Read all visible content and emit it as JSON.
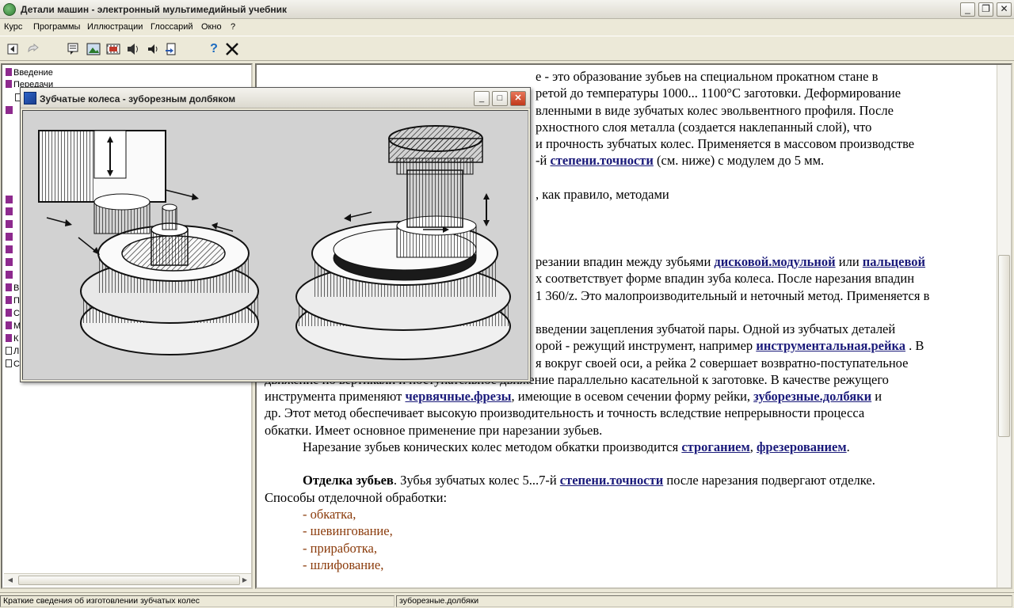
{
  "window": {
    "title": "Детали машин - электронный мультимедийный учебник",
    "minimize": "_",
    "maximize": "❐",
    "close": "✕"
  },
  "menu": [
    "Курс",
    "Программы",
    "Иллюстрации",
    "Глоссарий",
    "Окно",
    "?"
  ],
  "tree": {
    "top_items": [
      "Введение",
      "Передачи"
    ],
    "bottom_items": [
      "В",
      "П",
      "С",
      "М",
      "К",
      "Л",
      "С"
    ]
  },
  "popup": {
    "title": "Зубчатые колеса - зуборезным долбяком",
    "minimize": "_",
    "maximize": "□",
    "close": "✕"
  },
  "content": {
    "lines": [
      {
        "type": "plain",
        "text": "е - это образование зубьев на специальном прокатном стане в"
      },
      {
        "type": "plain",
        "text": "ретой до температуры 1000... 1100°С заготовки. Деформирование"
      },
      {
        "type": "plain",
        "text": "вленными в виде зубчатых колес эвольвентного профиля. После"
      },
      {
        "type": "plain",
        "text": "рхностного слоя металла (создается наклепанный слой), что"
      },
      {
        "type": "plain",
        "text": "и прочность зубчатых колес. Применяется в массовом производстве"
      }
    ],
    "line6_pre": "-й ",
    "line6_link": "степени.точности",
    "line6_post": " (см. ниже) с модулем до 5 мм.",
    "line7": ", как правило, методами",
    "line8_pre": "резании впадин между зубьями ",
    "line8_link1": "дисковой.модульной",
    "line8_mid": " или ",
    "line8_link2": "пальцевой",
    "line9": "х соответствует форме впадин зуба колеса. После нарезания впадин",
    "line10": "1 360/z. Это малопроизводительный и неточный метод.  Применяется  в",
    "line11": "введении зацепления зубчатой пары. Одной из зубчатых деталей",
    "line12_pre": "орой - режущий инструмент, например ",
    "line12_link": "инструментальная.рейка",
    "line12_post": " . В",
    "line13": "я вокруг своей оси, а рейка 2 совершает возвратно-поступательное",
    "line14": "движение по вертикали и поступательное движение параллельно касательной к заготовке. В качестве режущего",
    "line15_pre": "инструмента применяют ",
    "line15_link1": "червячные.фрезы",
    "line15_mid": ", имеющие в осевом сечении форму рейки, ",
    "line15_link2": "зуборезные.долбяки",
    "line15_post": " и",
    "line16": "др. Этот метод обеспечивает высокую производительность и точность вследствие непрерывности процесса",
    "line17": "обкатки. Имеет основное применение при нарезании зубьев.",
    "line18_pre": "Нарезание зубьев конических колес методом обкатки производится ",
    "line18_link1": "строганием",
    "line18_mid": ", ",
    "line18_link2": "фрезерованием",
    "line18_post": ".",
    "finish_title": "Отделка зубьев",
    "finish_pre": ". Зубья зубчатых колес 5...7-й ",
    "finish_link": "степени.точности",
    "finish_post": " после нарезания подвергают отделке.",
    "methods_title": "Способы отделочной обработки:",
    "methods": [
      "- обкатка,",
      "- шевингование,",
      "- приработка,",
      "- шлифование,"
    ]
  },
  "status": {
    "left": "Краткие сведения об изготовлении зубчатых колес",
    "right": "зуборезные.долбяки"
  },
  "colors": {
    "link": "#1a1a7a",
    "method_text": "#8a3a0a",
    "tree_book": "#8e2a8e"
  },
  "icons": [
    "back-icon",
    "forward-icon",
    "note-icon",
    "image-icon",
    "movie-icon",
    "sound-icon",
    "export-icon",
    "help-icon",
    "exit-icon"
  ]
}
